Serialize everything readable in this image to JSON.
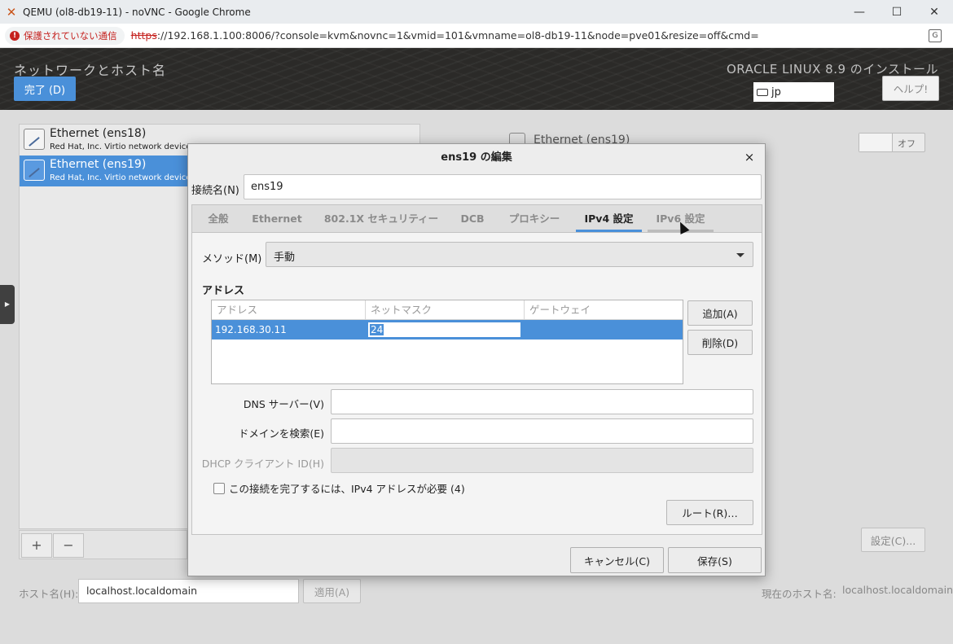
{
  "browser": {
    "window_title": "QEMU (ol8-db19-11) - noVNC - Google Chrome",
    "insecure_label": "保護されていない通信",
    "url_scheme": "https",
    "url_rest": "://192.168.1.100:8006/?console=kvm&novnc=1&vmid=101&vmname=ol8-db19-11&node=pve01&resize=off&cmd=",
    "controls": {
      "minimize": "—",
      "maximize": "☐",
      "close": "✕"
    }
  },
  "installer": {
    "page_title": "ネットワークとホスト名",
    "done_button": "完了 (D)",
    "product": "ORACLE LINUX 8.9 のインストール",
    "keyboard_layout": "jp",
    "help_button": "ヘルプ!"
  },
  "devices": [
    {
      "name": "Ethernet (ens18)",
      "desc": "Red Hat, Inc. Virtio network device"
    },
    {
      "name": "Ethernet (ens19)",
      "desc": "Red Hat, Inc. Virtio network device"
    }
  ],
  "list_tools": {
    "add": "+",
    "remove": "−"
  },
  "detail": {
    "name": "Ethernet (ens19)",
    "toggle_label": "オフ",
    "config_button": "設定(C)..."
  },
  "hostname": {
    "label": "ホスト名(H):",
    "value": "localhost.localdomain",
    "apply_button": "適用(A)",
    "current_label": "現在のホスト名:",
    "current_value": "localhost.localdomain"
  },
  "dialog": {
    "title": "ens19 の編集",
    "close": "×",
    "conn_name_label": "接続名(N)",
    "conn_name_value": "ens19",
    "tabs": [
      "全般",
      "Ethernet",
      "802.1X セキュリティー",
      "DCB",
      "プロキシー",
      "IPv4 設定",
      "IPv6 設定"
    ],
    "method_label": "メソッド(M)",
    "method_value": "手動",
    "address_heading": "アドレス",
    "address_columns": [
      "アドレス",
      "ネットマスク",
      "ゲートウェイ"
    ],
    "address_rows": [
      {
        "address": "192.168.30.11",
        "netmask": "24",
        "gateway": ""
      }
    ],
    "add_button": "追加(A)",
    "delete_button": "削除(D)",
    "dns_label": "DNS サーバー(V)",
    "search_label": "ドメインを検索(E)",
    "dhcp_label": "DHCP クライアント ID(H)",
    "require_ipv4_label": "この接続を完了するには、IPv4 アドレスが必要 (4)",
    "route_button": "ルート(R)…",
    "cancel_button": "キャンセル(C)",
    "save_button": "保存(S)"
  },
  "colors": {
    "accent": "#4a90d9",
    "header_bg": "#2b2a28",
    "insecure": "#c5221f"
  }
}
